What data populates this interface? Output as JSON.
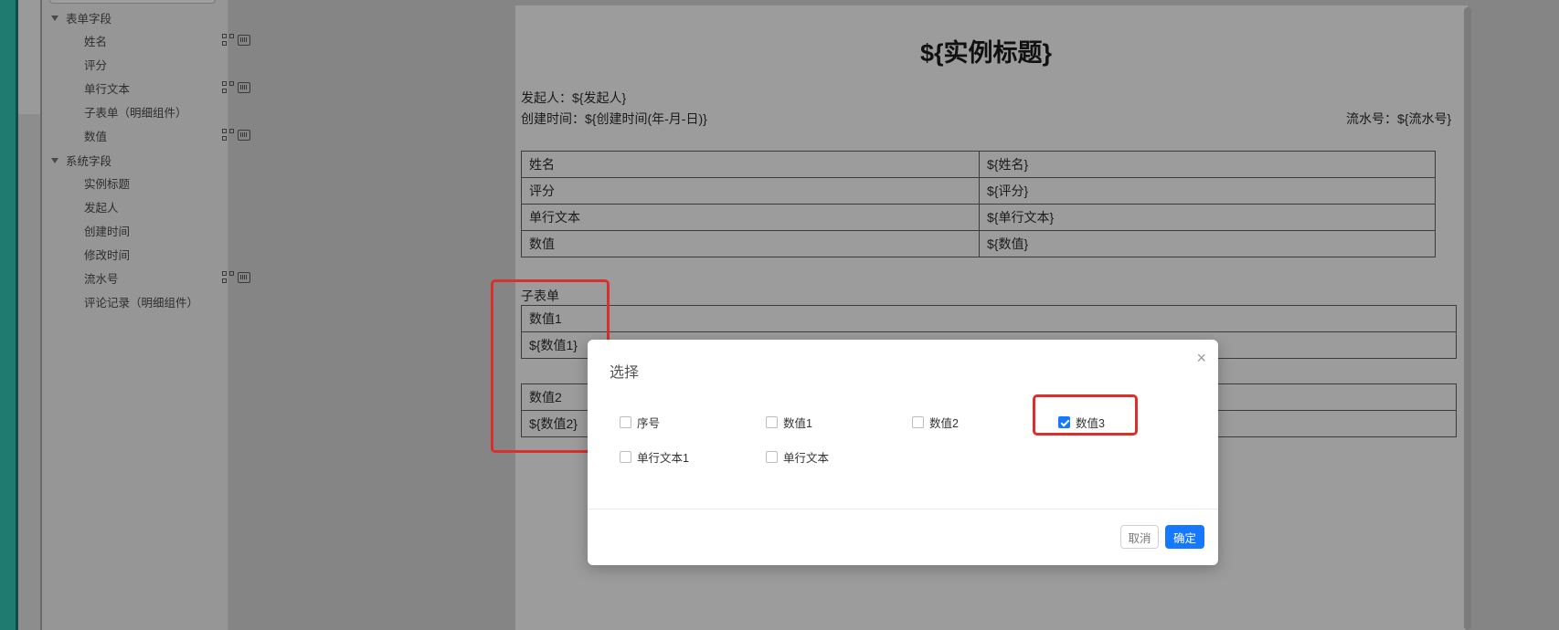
{
  "sidebar": {
    "groups": [
      {
        "label": "表单字段",
        "items": [
          {
            "label": "姓名",
            "icons": [
              "qr-code-icon",
              "barcode-icon"
            ]
          },
          {
            "label": "评分",
            "icons": []
          },
          {
            "label": "单行文本",
            "icons": [
              "qr-code-icon",
              "barcode-icon"
            ]
          },
          {
            "label": "子表单（明细组件）",
            "icons": []
          },
          {
            "label": "数值",
            "icons": [
              "qr-code-icon",
              "barcode-icon"
            ]
          }
        ]
      },
      {
        "label": "系统字段",
        "items": [
          {
            "label": "实例标题",
            "icons": []
          },
          {
            "label": "发起人",
            "icons": []
          },
          {
            "label": "创建时间",
            "icons": []
          },
          {
            "label": "修改时间",
            "icons": []
          },
          {
            "label": "流水号",
            "icons": [
              "qr-code-icon",
              "barcode-icon"
            ]
          },
          {
            "label": "评论记录（明细组件）",
            "icons": []
          }
        ]
      }
    ]
  },
  "document": {
    "title": "${实例标题}",
    "initiator": "发起人：${发起人}",
    "created": "创建时间：${创建时间(年-月-日)}",
    "serial": "流水号：${流水号}",
    "main_table": [
      [
        "姓名",
        "${姓名}"
      ],
      [
        "评分",
        "${评分}"
      ],
      [
        "单行文本",
        "${单行文本}"
      ],
      [
        "数值",
        "${数值}"
      ]
    ],
    "subform_label": "子表单",
    "subtable1": [
      "数值1",
      "${数值1}"
    ],
    "subtable2": [
      "数值2",
      "${数值2}"
    ]
  },
  "modal": {
    "title": "选择",
    "close": "×",
    "options": [
      {
        "label": "序号",
        "checked": false
      },
      {
        "label": "数值1",
        "checked": false
      },
      {
        "label": "数值2",
        "checked": false
      },
      {
        "label": "数值3",
        "checked": true
      },
      {
        "label": "单行文本1",
        "checked": false
      },
      {
        "label": "单行文本",
        "checked": false
      }
    ],
    "cancel": "取消",
    "ok": "确定"
  },
  "colors": {
    "primary": "#1677ff",
    "highlight": "#d8302c"
  }
}
